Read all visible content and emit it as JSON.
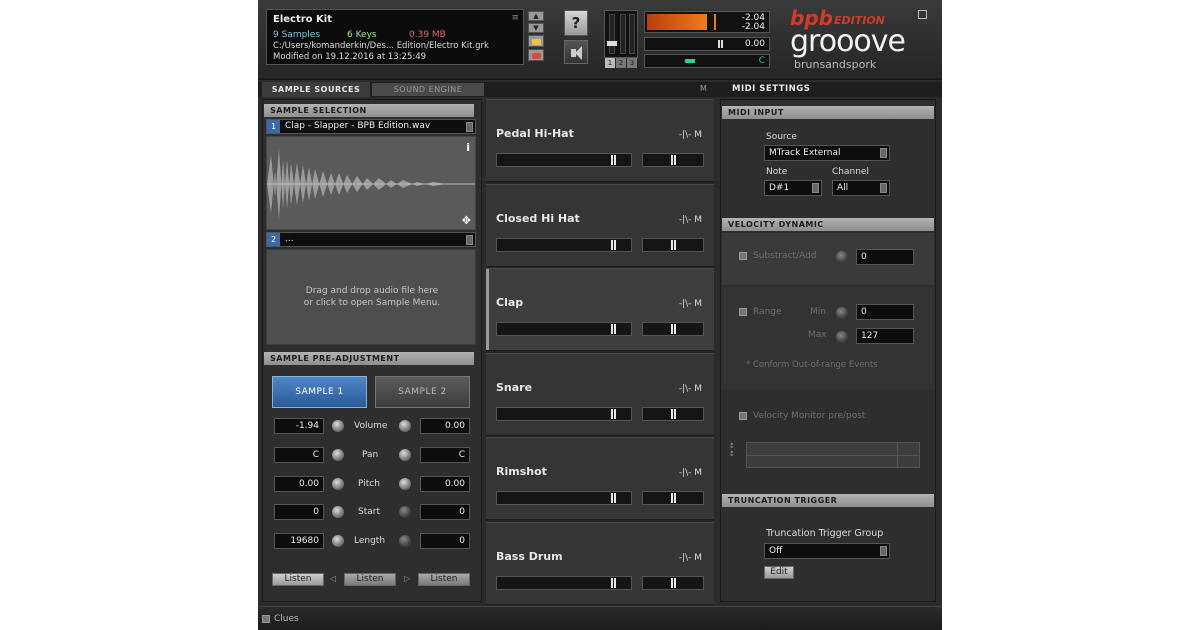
{
  "header": {
    "kit_name": "Electro Kit",
    "sample_count": "9 Samples",
    "key_count": "6 Keys",
    "size": "0.39 MB",
    "path": "C:/Users/komanderkin/Des... Edition/Electro Kit.grk",
    "modified": "Modified on 19.12.2016 at 13:25:49",
    "help_glyph": "?",
    "meter_value_1": "-2.04",
    "meter_value_2": "-2.04",
    "tune_value": "0.00",
    "pan_value": "C",
    "output_btn_1": "1",
    "output_btn_2": "2",
    "output_btn_3": "3"
  },
  "logo": {
    "brand_1": "bpb",
    "brand_2": "EDITION",
    "product": "grooove",
    "company": "brunsandspork"
  },
  "tabs": {
    "sample_sources": "SAMPLE SOURCES",
    "sound_engine": "SOUND ENGINE",
    "midi_settings": "MIDI SETTINGS",
    "m_marker": "M"
  },
  "sample_selection": {
    "title": "SAMPLE SELECTION",
    "slot1_number": "1",
    "slot1_file": "Clap - Slapper - BPB Edition.wav",
    "info_glyph": "i",
    "move_glyph": "✥",
    "slot2_number": "2",
    "slot2_file": "...",
    "drop_line_1": "Drag and drop audio file here",
    "drop_line_2": "or click to open Sample Menu."
  },
  "pre_adjust": {
    "title": "SAMPLE PRE-ADJUSTMENT",
    "sample1_btn": "SAMPLE 1",
    "sample2_btn": "SAMPLE 2",
    "rows": [
      {
        "label": "Volume",
        "left": "-1.94",
        "right": "0.00"
      },
      {
        "label": "Pan",
        "left": "C",
        "right": "C"
      },
      {
        "label": "Pitch",
        "left": "0.00",
        "right": "0.00"
      },
      {
        "label": "Start",
        "left": "0",
        "right": "0"
      },
      {
        "label": "Length",
        "left": "19680",
        "right": "0"
      }
    ],
    "listen_label": "Listen"
  },
  "pads": [
    {
      "name": "Pedal Hi-Hat",
      "volume": 0.88,
      "pan": 0.5
    },
    {
      "name": "Closed Hi Hat",
      "volume": 0.88,
      "pan": 0.5
    },
    {
      "name": "Clap",
      "volume": 0.88,
      "pan": 0.5
    },
    {
      "name": "Snare",
      "volume": 0.88,
      "pan": 0.5
    },
    {
      "name": "Rimshot",
      "volume": 0.88,
      "pan": 0.5
    },
    {
      "name": "Bass Drum",
      "volume": 0.88,
      "pan": 0.5
    }
  ],
  "pad_wave_glyph": "-|\\- M",
  "midi_input": {
    "title": "MIDI INPUT",
    "source_label": "Source",
    "source_value": "MTrack External",
    "note_label": "Note",
    "note_value": "D#1",
    "channel_label": "Channel",
    "channel_value": "All"
  },
  "velocity": {
    "title": "VELOCITY DYNAMIC",
    "subtract_label": "Substract/Add",
    "subtract_value": "0",
    "range_label": "Range",
    "min_label": "Min",
    "min_value": "0",
    "max_label": "Max",
    "max_value": "127",
    "conform_note": "* Conform Out-of-range Events",
    "monitor_label": "Velocity Monitor pre/post"
  },
  "truncation": {
    "title": "TRUNCATION TRIGGER",
    "group_label": "Truncation Trigger Group",
    "group_value": "Off",
    "edit_btn": "Edit"
  },
  "footer": {
    "clues_label": "Clues"
  }
}
